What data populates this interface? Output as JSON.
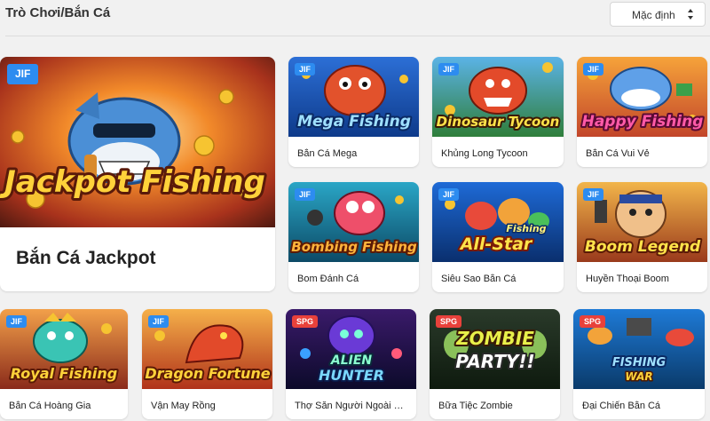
{
  "header": {
    "title": "Trò Chơi/Bắn Cá",
    "sort_label": "Mặc định"
  },
  "featured": {
    "name": "Bắn Cá Jackpot",
    "badge": "JIF",
    "logo": "Jackpot Fishing"
  },
  "games": [
    {
      "name": "Bắn Cá Mega",
      "badge": "JIF",
      "logo": "Mega Fishing"
    },
    {
      "name": "Khủng Long Tycoon",
      "badge": "JIF",
      "logo": "Dinosaur Tycoon"
    },
    {
      "name": "Bắn Cá Vui Vẻ",
      "badge": "JIF",
      "logo": "Happy Fishing"
    },
    {
      "name": "Bom Đánh Cá",
      "badge": "JIF",
      "logo": "Bombing Fishing"
    },
    {
      "name": "Siêu Sao Bắn Cá",
      "badge": "JIF",
      "logo": "All-Star",
      "logo2": "Fishing"
    },
    {
      "name": "Huyền Thoại Boom",
      "badge": "JIF",
      "logo": "Boom Legend"
    },
    {
      "name": "Bắn Cá Hoàng Gia",
      "badge": "JIF",
      "logo": "Royal Fishing"
    },
    {
      "name": "Vận May Rồng",
      "badge": "JIF",
      "logo": "Dragon Fortune"
    },
    {
      "name": "Thợ Săn Người Ngoài Hà...",
      "badge": "SPG",
      "logo": "ALIEN",
      "logo2": "HUNTER"
    },
    {
      "name": "Bữa Tiệc Zombie",
      "badge": "SPG",
      "logo": "ZOMBIE",
      "logo2": "PARTY!!"
    },
    {
      "name": "Đại Chiến Bắn Cá",
      "badge": "SPG",
      "logo": "FISHING",
      "logo2": "WAR"
    }
  ],
  "colors": {
    "badge_jif": "#2d8cf0",
    "badge_spg": "#e8413b",
    "background": "#f1f1f1"
  },
  "icons": {
    "sort": "up-down-arrows-icon"
  }
}
